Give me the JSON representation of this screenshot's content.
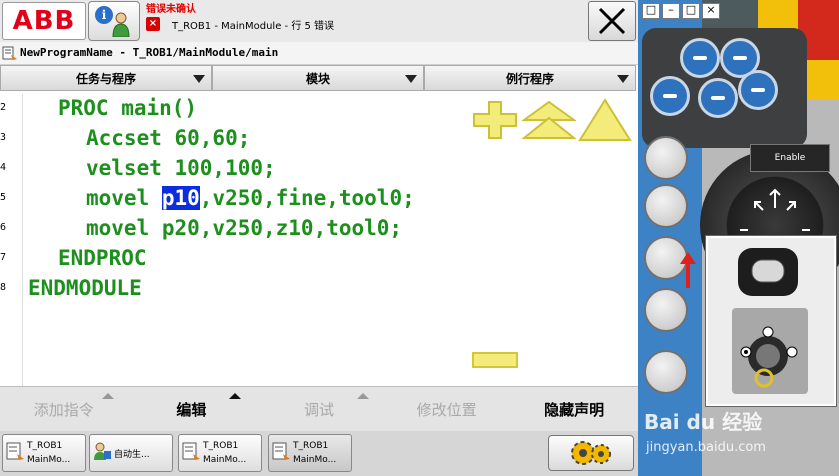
{
  "topbar": {
    "logo": "ABB",
    "info_icon": "info-user-icon",
    "status_title": "错误未确认",
    "error_badge": "×",
    "status_message": "T_ROB1 - MainModule - 行 5 错误",
    "close_icon": "close-x-icon"
  },
  "path": "NewProgramName - T_ROB1/MainModule/main",
  "tabs": [
    {
      "label": "任务与程序"
    },
    {
      "label": "模块"
    },
    {
      "label": "例行程序"
    }
  ],
  "code": {
    "lines": [
      {
        "num": "2",
        "text": "PROC main()"
      },
      {
        "num": "3",
        "text": "Accset 60,60;"
      },
      {
        "num": "4",
        "text": "velset 100,100;"
      },
      {
        "num": "5",
        "pre": "movel ",
        "selected": "p10",
        "post": ",v250,fine,tool0;"
      },
      {
        "num": "6",
        "text": "movel p20,v250,z10,tool0;"
      },
      {
        "num": "7",
        "text": "ENDPROC"
      },
      {
        "num": "8",
        "text": "ENDMODULE"
      }
    ]
  },
  "bottom_menu": [
    {
      "label": "添加指令",
      "enabled": false
    },
    {
      "label": "编辑",
      "enabled": true
    },
    {
      "label": "调试",
      "enabled": false
    },
    {
      "label": "修改位置",
      "enabled": false
    },
    {
      "label": "隐藏声明",
      "enabled": true
    }
  ],
  "taskbar": [
    {
      "line1": "T_ROB1",
      "line2": "MainMo..."
    },
    {
      "line1": "自动生...",
      "line2": ""
    },
    {
      "line1": "T_ROB1",
      "line2": "MainMo..."
    },
    {
      "line1": "T_ROB1",
      "line2": "MainMo..."
    }
  ],
  "device": {
    "enable_label": "Enable",
    "watermark_line1": "Bai du 经验",
    "watermark_line2": "jingyan.baidu.com"
  },
  "colors": {
    "abb_red": "#e2001a",
    "code_green": "#1d8f1d",
    "selection_blue": "#0a2de0",
    "arrow_yellow": "#f3ec7a"
  }
}
